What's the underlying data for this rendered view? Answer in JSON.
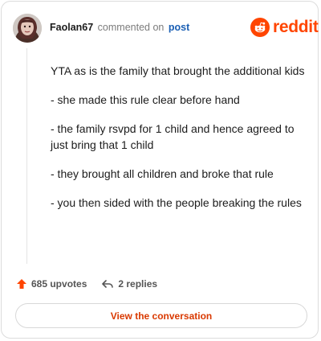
{
  "header": {
    "username": "Faolan67",
    "action": "commented on",
    "target": "post",
    "brand": "reddit"
  },
  "comment": {
    "paragraphs": [
      "YTA as is the family that brought the additional kids",
      "- she made this rule clear before hand",
      "- the family rsvpd for 1 child and hence agreed to just bring that 1 child",
      "- they brought all children and broke that rule",
      "- you then sided with the people breaking the rules"
    ]
  },
  "stats": {
    "upvotes_label": "685 upvotes",
    "replies_label": "2 replies"
  },
  "cta": {
    "label": "View the conversation"
  },
  "colors": {
    "brand": "#ff4500",
    "link": "#1a5fb4",
    "cta_text": "#d93900"
  },
  "icons": {
    "avatar": "user-avatar",
    "brand": "reddit-alien-icon",
    "upvote": "upvote-arrow-icon",
    "reply": "reply-arrow-icon"
  }
}
